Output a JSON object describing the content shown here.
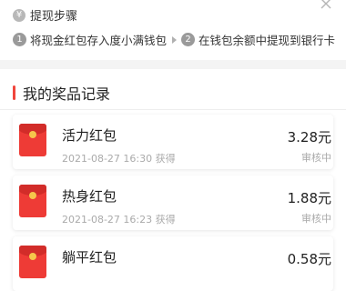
{
  "steps": {
    "title": "提现步骤",
    "step1_num": "1",
    "step1_text": "将现金红包存入度小满钱包",
    "step2_num": "2",
    "step2_text": "在钱包余额中提现到银行卡"
  },
  "records": {
    "title": "我的奖品记录",
    "items": [
      {
        "name": "活力红包",
        "time": "2021-08-27 16:30 获得",
        "amount": "3.28元",
        "status": "审核中"
      },
      {
        "name": "热身红包",
        "time": "2021-08-27 16:23 获得",
        "amount": "1.88元",
        "status": "审核中"
      },
      {
        "name": "躺平红包",
        "time": "",
        "amount": "0.58元",
        "status": ""
      }
    ]
  },
  "colors": {
    "accent": "#f0463c",
    "envelope": "#ee3b36"
  }
}
